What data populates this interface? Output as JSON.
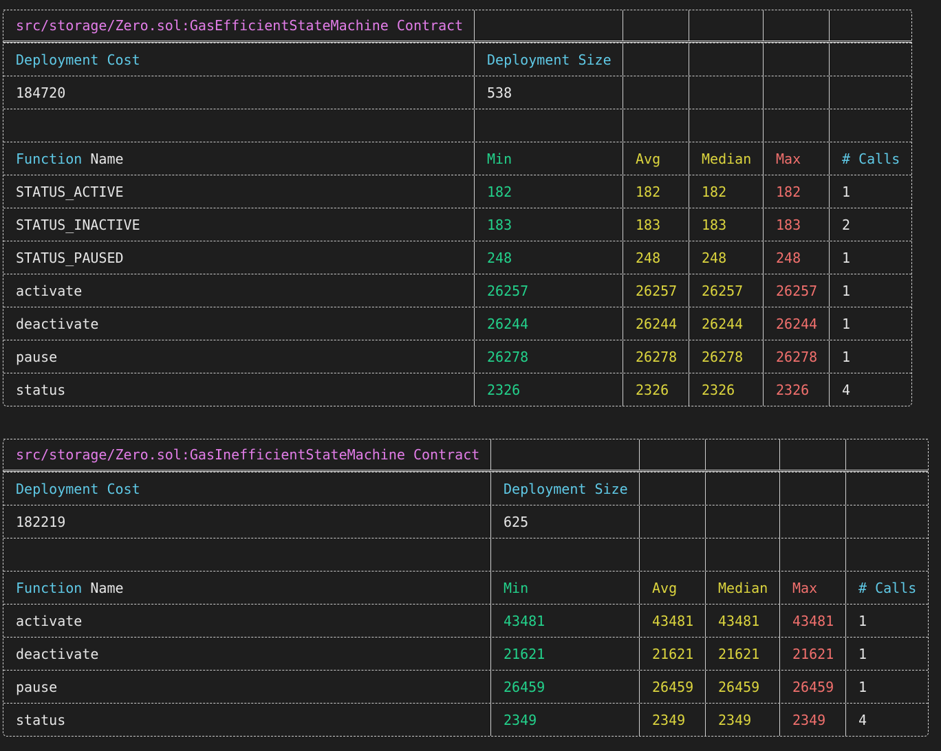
{
  "colors": {
    "background": "#1e1e1e",
    "contract_title": "#e27de8",
    "header_cyan": "#5fc9e6",
    "min_green": "#23d18b",
    "avg_median_yellow": "#dcd53e",
    "max_red": "#f1706d",
    "text_white": "#e6e6e6"
  },
  "tables": [
    {
      "contract": "src/storage/Zero.sol:GasEfficientStateMachine Contract",
      "deployment_cost_label": "Deployment Cost",
      "deployment_size_label": "Deployment Size",
      "deployment_cost": "184720",
      "deployment_size": "538",
      "headers": {
        "function": "Function",
        "name": "Name",
        "min": "Min",
        "avg": "Avg",
        "median": "Median",
        "max": "Max",
        "calls": "# Calls"
      },
      "rows": [
        {
          "name": "STATUS_ACTIVE",
          "min": "182",
          "avg": "182",
          "median": "182",
          "max": "182",
          "calls": "1"
        },
        {
          "name": "STATUS_INACTIVE",
          "min": "183",
          "avg": "183",
          "median": "183",
          "max": "183",
          "calls": "2"
        },
        {
          "name": "STATUS_PAUSED",
          "min": "248",
          "avg": "248",
          "median": "248",
          "max": "248",
          "calls": "1"
        },
        {
          "name": "activate",
          "min": "26257",
          "avg": "26257",
          "median": "26257",
          "max": "26257",
          "calls": "1"
        },
        {
          "name": "deactivate",
          "min": "26244",
          "avg": "26244",
          "median": "26244",
          "max": "26244",
          "calls": "1"
        },
        {
          "name": "pause",
          "min": "26278",
          "avg": "26278",
          "median": "26278",
          "max": "26278",
          "calls": "1"
        },
        {
          "name": "status",
          "min": "2326",
          "avg": "2326",
          "median": "2326",
          "max": "2326",
          "calls": "4"
        }
      ]
    },
    {
      "contract": "src/storage/Zero.sol:GasInefficientStateMachine Contract",
      "deployment_cost_label": "Deployment Cost",
      "deployment_size_label": "Deployment Size",
      "deployment_cost": "182219",
      "deployment_size": "625",
      "headers": {
        "function": "Function",
        "name": "Name",
        "min": "Min",
        "avg": "Avg",
        "median": "Median",
        "max": "Max",
        "calls": "# Calls"
      },
      "rows": [
        {
          "name": "activate",
          "min": "43481",
          "avg": "43481",
          "median": "43481",
          "max": "43481",
          "calls": "1"
        },
        {
          "name": "deactivate",
          "min": "21621",
          "avg": "21621",
          "median": "21621",
          "max": "21621",
          "calls": "1"
        },
        {
          "name": "pause",
          "min": "26459",
          "avg": "26459",
          "median": "26459",
          "max": "26459",
          "calls": "1"
        },
        {
          "name": "status",
          "min": "2349",
          "avg": "2349",
          "median": "2349",
          "max": "2349",
          "calls": "4"
        }
      ]
    }
  ]
}
